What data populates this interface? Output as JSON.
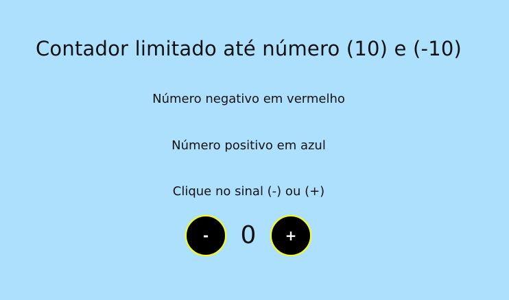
{
  "page": {
    "title": "Contador limitado até número (10) e (-10)",
    "negative_note": "Número negativo em vermelho",
    "positive_note": "Número positivo em azul",
    "hint": "Clique no sinal (-) ou (+)"
  },
  "counter": {
    "decrement_label": "-",
    "value": "0",
    "increment_label": "+"
  },
  "colors": {
    "background": "#ade0fc",
    "button_fill": "#000000",
    "button_border": "#ffff00",
    "negative_color": "#ff0000",
    "positive_color": "#0000ff"
  }
}
